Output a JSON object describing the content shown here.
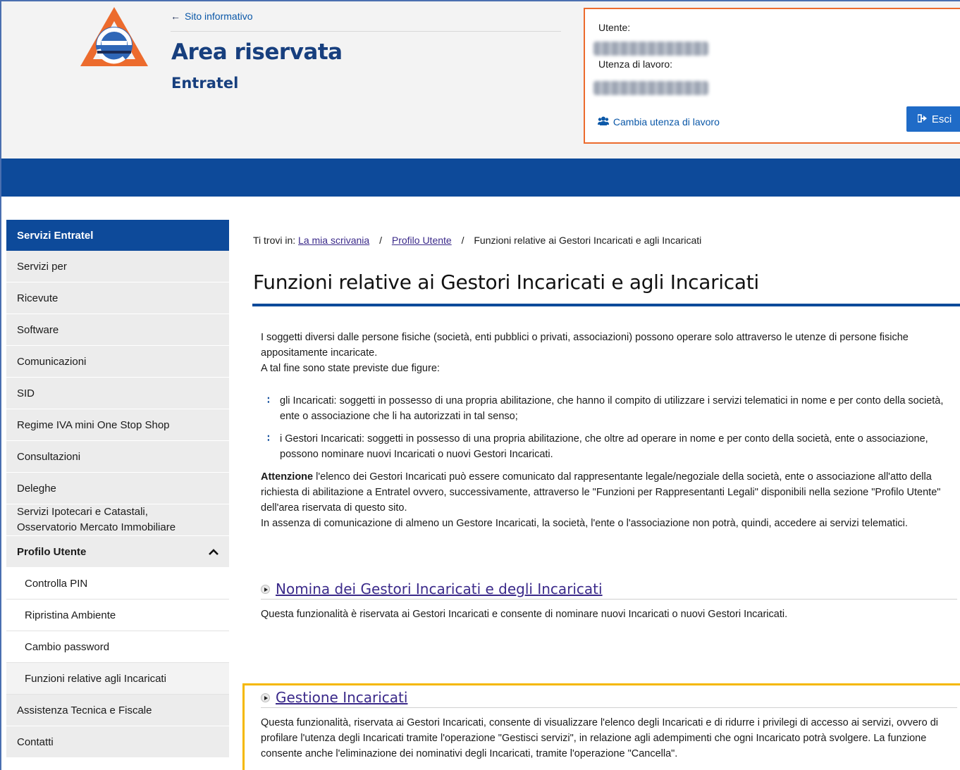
{
  "header": {
    "back_link": "Sito informativo",
    "title": "Area riservata",
    "subtitle": "Entratel",
    "user_label": "Utente:",
    "work_user_label": "Utenza di lavoro:",
    "switch_user_link": "Cambia utenza di lavoro",
    "logout_button": "Esci"
  },
  "sidebar": {
    "header": "Servizi Entratel",
    "items": [
      "Servizi per",
      "Ricevute",
      "Software",
      "Comunicazioni",
      "SID",
      "Regime IVA mini One Stop Shop",
      "Consultazioni",
      "Deleghe"
    ],
    "ipotecari_line1": "Servizi Ipotecari e Catastali,",
    "ipotecari_line2": "Osservatorio Mercato Immobiliare",
    "profile_group": "Profilo Utente",
    "profile_subitems": [
      "Controlla PIN",
      "Ripristina Ambiente",
      "Cambio password",
      "Funzioni relative agli Incaricati"
    ],
    "after_items": [
      "Assistenza Tecnica e Fiscale",
      "Contatti"
    ]
  },
  "breadcrumb": {
    "prefix": "Ti trovi in:",
    "crumb1": "La mia scrivania",
    "crumb2": "Profilo Utente",
    "current": "Funzioni relative ai Gestori Incaricati e agli Incaricati",
    "separator": "/"
  },
  "main": {
    "title": "Funzioni relative ai Gestori Incaricati e agli Incaricati",
    "intro1": "I soggetti diversi dalle persone fisiche (società, enti pubblici o privati, associazioni) possono operare solo attraverso le utenze di persone fisiche appositamente incaricate.",
    "intro2": "A tal fine sono state previste due figure:",
    "bullet1": "gli Incaricati: soggetti in possesso di una propria abilitazione, che hanno il compito di utilizzare i servizi telematici in nome e per conto della società, ente o associazione che li ha autorizzati in tal senso;",
    "bullet2": "i Gestori Incaricati: soggetti in possesso di una propria abilitazione, che oltre ad operare in nome e per conto della società, ente o associazione, possono nominare nuovi Incaricati o nuovi Gestori Incaricati.",
    "attention_label": "Attenzione",
    "attention_text": " l'elenco dei Gestori Incaricati può essere comunicato dal rappresentante legale/negoziale della società, ente o associazione all'atto della richiesta di abilitazione a Entratel ovvero, successivamente, attraverso le \"Funzioni per Rappresentanti Legali\" disponibili nella sezione \"Profilo Utente\" dell'area riservata di questo sito.",
    "attention_text2": "In assenza di comunicazione di almeno un Gestore Incaricati, la società, l'ente o l'associazione non potrà, quindi, accedere ai servizi telematici."
  },
  "sections": {
    "nomina_title": "Nomina dei Gestori Incaricati e degli Incaricati",
    "nomina_desc": "Questa funzionalità è riservata ai Gestori Incaricati e consente di nominare nuovi Incaricati o nuovi Gestori Incaricati.",
    "gestione_title": "Gestione Incaricati",
    "gestione_desc": "Questa funzionalità, riservata ai Gestori Incaricati, consente di visualizzare l'elenco degli Incaricati e di ridurre i privilegi di accesso ai servizi, ovvero di profilare l'utenza degli Incaricati tramite l'operazione \"Gestisci servizi\", in relazione agli adempimenti che ogni Incaricato potrà svolgere. La funzione consente anche l'eliminazione dei nominativi degli Incaricati, tramite l'operazione \"Cancella\"."
  },
  "colors": {
    "brand_blue": "#0d4a9a",
    "title_blue": "#173f7e",
    "highlight_orange": "#ec6b2d",
    "highlight_yellow": "#f5b800",
    "link_purple": "#3b2a8a"
  },
  "icons": {
    "back": "arrow-left-icon",
    "users": "users-icon",
    "logout": "sign-out-icon",
    "chevron": "chevron-up-icon",
    "bullet": "bullet-dots-icon",
    "section": "play-circle-icon"
  }
}
